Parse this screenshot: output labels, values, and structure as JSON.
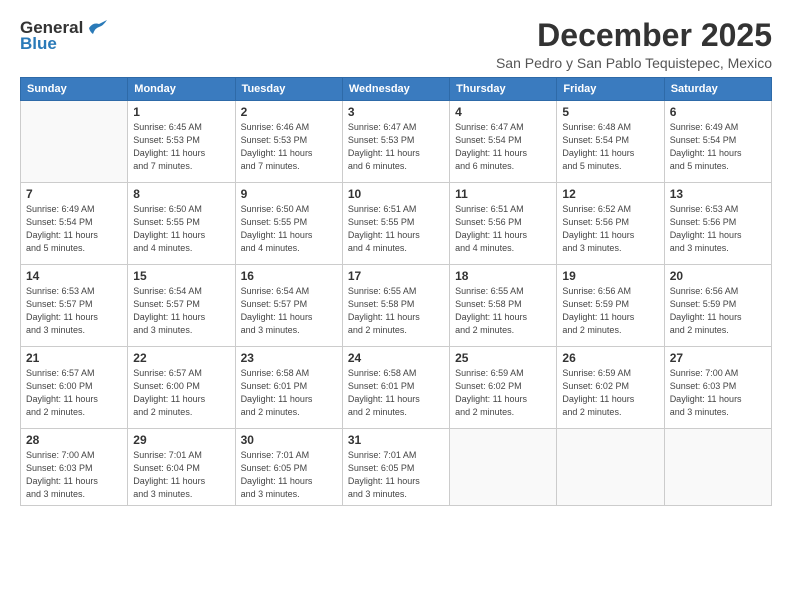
{
  "logo": {
    "line1": "General",
    "line2": "Blue"
  },
  "header": {
    "month": "December 2025",
    "location": "San Pedro y San Pablo Tequistepec, Mexico"
  },
  "weekdays": [
    "Sunday",
    "Monday",
    "Tuesday",
    "Wednesday",
    "Thursday",
    "Friday",
    "Saturday"
  ],
  "weeks": [
    [
      {
        "day": "",
        "info": ""
      },
      {
        "day": "1",
        "info": "Sunrise: 6:45 AM\nSunset: 5:53 PM\nDaylight: 11 hours\nand 7 minutes."
      },
      {
        "day": "2",
        "info": "Sunrise: 6:46 AM\nSunset: 5:53 PM\nDaylight: 11 hours\nand 7 minutes."
      },
      {
        "day": "3",
        "info": "Sunrise: 6:47 AM\nSunset: 5:53 PM\nDaylight: 11 hours\nand 6 minutes."
      },
      {
        "day": "4",
        "info": "Sunrise: 6:47 AM\nSunset: 5:54 PM\nDaylight: 11 hours\nand 6 minutes."
      },
      {
        "day": "5",
        "info": "Sunrise: 6:48 AM\nSunset: 5:54 PM\nDaylight: 11 hours\nand 5 minutes."
      },
      {
        "day": "6",
        "info": "Sunrise: 6:49 AM\nSunset: 5:54 PM\nDaylight: 11 hours\nand 5 minutes."
      }
    ],
    [
      {
        "day": "7",
        "info": "Sunrise: 6:49 AM\nSunset: 5:54 PM\nDaylight: 11 hours\nand 5 minutes."
      },
      {
        "day": "8",
        "info": "Sunrise: 6:50 AM\nSunset: 5:55 PM\nDaylight: 11 hours\nand 4 minutes."
      },
      {
        "day": "9",
        "info": "Sunrise: 6:50 AM\nSunset: 5:55 PM\nDaylight: 11 hours\nand 4 minutes."
      },
      {
        "day": "10",
        "info": "Sunrise: 6:51 AM\nSunset: 5:55 PM\nDaylight: 11 hours\nand 4 minutes."
      },
      {
        "day": "11",
        "info": "Sunrise: 6:51 AM\nSunset: 5:56 PM\nDaylight: 11 hours\nand 4 minutes."
      },
      {
        "day": "12",
        "info": "Sunrise: 6:52 AM\nSunset: 5:56 PM\nDaylight: 11 hours\nand 3 minutes."
      },
      {
        "day": "13",
        "info": "Sunrise: 6:53 AM\nSunset: 5:56 PM\nDaylight: 11 hours\nand 3 minutes."
      }
    ],
    [
      {
        "day": "14",
        "info": "Sunrise: 6:53 AM\nSunset: 5:57 PM\nDaylight: 11 hours\nand 3 minutes."
      },
      {
        "day": "15",
        "info": "Sunrise: 6:54 AM\nSunset: 5:57 PM\nDaylight: 11 hours\nand 3 minutes."
      },
      {
        "day": "16",
        "info": "Sunrise: 6:54 AM\nSunset: 5:57 PM\nDaylight: 11 hours\nand 3 minutes."
      },
      {
        "day": "17",
        "info": "Sunrise: 6:55 AM\nSunset: 5:58 PM\nDaylight: 11 hours\nand 2 minutes."
      },
      {
        "day": "18",
        "info": "Sunrise: 6:55 AM\nSunset: 5:58 PM\nDaylight: 11 hours\nand 2 minutes."
      },
      {
        "day": "19",
        "info": "Sunrise: 6:56 AM\nSunset: 5:59 PM\nDaylight: 11 hours\nand 2 minutes."
      },
      {
        "day": "20",
        "info": "Sunrise: 6:56 AM\nSunset: 5:59 PM\nDaylight: 11 hours\nand 2 minutes."
      }
    ],
    [
      {
        "day": "21",
        "info": "Sunrise: 6:57 AM\nSunset: 6:00 PM\nDaylight: 11 hours\nand 2 minutes."
      },
      {
        "day": "22",
        "info": "Sunrise: 6:57 AM\nSunset: 6:00 PM\nDaylight: 11 hours\nand 2 minutes."
      },
      {
        "day": "23",
        "info": "Sunrise: 6:58 AM\nSunset: 6:01 PM\nDaylight: 11 hours\nand 2 minutes."
      },
      {
        "day": "24",
        "info": "Sunrise: 6:58 AM\nSunset: 6:01 PM\nDaylight: 11 hours\nand 2 minutes."
      },
      {
        "day": "25",
        "info": "Sunrise: 6:59 AM\nSunset: 6:02 PM\nDaylight: 11 hours\nand 2 minutes."
      },
      {
        "day": "26",
        "info": "Sunrise: 6:59 AM\nSunset: 6:02 PM\nDaylight: 11 hours\nand 2 minutes."
      },
      {
        "day": "27",
        "info": "Sunrise: 7:00 AM\nSunset: 6:03 PM\nDaylight: 11 hours\nand 3 minutes."
      }
    ],
    [
      {
        "day": "28",
        "info": "Sunrise: 7:00 AM\nSunset: 6:03 PM\nDaylight: 11 hours\nand 3 minutes."
      },
      {
        "day": "29",
        "info": "Sunrise: 7:01 AM\nSunset: 6:04 PM\nDaylight: 11 hours\nand 3 minutes."
      },
      {
        "day": "30",
        "info": "Sunrise: 7:01 AM\nSunset: 6:05 PM\nDaylight: 11 hours\nand 3 minutes."
      },
      {
        "day": "31",
        "info": "Sunrise: 7:01 AM\nSunset: 6:05 PM\nDaylight: 11 hours\nand 3 minutes."
      },
      {
        "day": "",
        "info": ""
      },
      {
        "day": "",
        "info": ""
      },
      {
        "day": "",
        "info": ""
      }
    ]
  ]
}
